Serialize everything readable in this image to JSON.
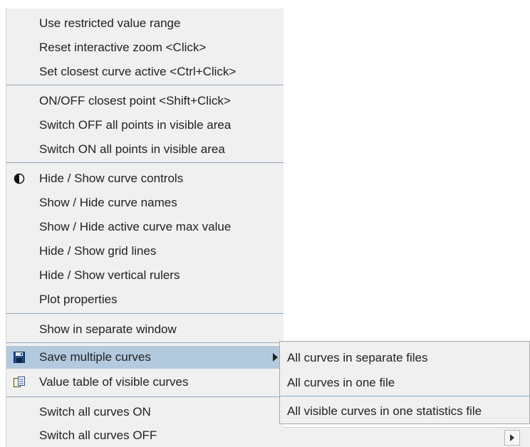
{
  "context_menu": {
    "items": [
      {
        "label": "Use restricted value range"
      },
      {
        "label": "Reset interactive zoom <Click>"
      },
      {
        "label": "Set closest curve active <Ctrl+Click>"
      },
      {
        "label": "ON/OFF closest point <Shift+Click>"
      },
      {
        "label": "Switch OFF all points in visible area"
      },
      {
        "label": "Switch ON all points in visible area"
      },
      {
        "label": "Hide / Show curve controls",
        "icon": "contrast-icon"
      },
      {
        "label": "Show / Hide curve names"
      },
      {
        "label": "Show / Hide active curve max value"
      },
      {
        "label": "Hide / Show grid lines"
      },
      {
        "label": "Hide / Show vertical rulers"
      },
      {
        "label": "Plot properties"
      },
      {
        "label": "Show in separate window"
      },
      {
        "label": "Save multiple curves",
        "icon": "save-disk-icon",
        "has_submenu": true,
        "highlighted": true
      },
      {
        "label": "Value table of visible curves",
        "icon": "table-copy-icon"
      },
      {
        "label": "Switch all curves ON"
      },
      {
        "label": "Switch all curves OFF"
      }
    ]
  },
  "submenu": {
    "items": [
      {
        "label": "All curves in separate files"
      },
      {
        "label": "All curves in one file"
      },
      {
        "label": "All visible curves in one statistics file"
      }
    ]
  },
  "colors": {
    "menu_bg": "#f0f0f0",
    "highlight": "#b3c9de",
    "separator": "#8fa7c2"
  }
}
